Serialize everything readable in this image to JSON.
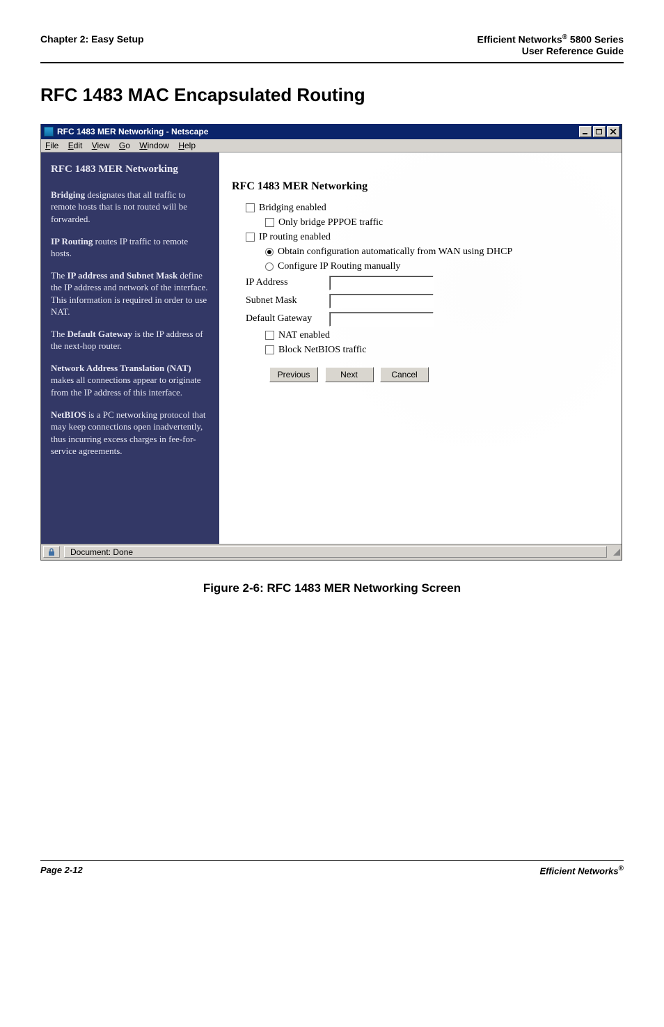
{
  "header": {
    "left": "Chapter 2: Easy Setup",
    "right_l1a": "Efficient Networks",
    "right_l1_sup": "®",
    "right_l1b": " 5800 Series",
    "right_l2": "User Reference Guide"
  },
  "heading_main": "RFC 1483 MAC Encapsulated Routing",
  "window": {
    "title": "RFC 1483 MER Networking - Netscape",
    "menus": {
      "file": "File",
      "edit": "Edit",
      "view": "View",
      "go": "Go",
      "window": "Window",
      "help": "Help"
    },
    "sidebar": {
      "title": "RFC 1483 MER Networking",
      "p1_a": "Bridging",
      "p1_b": " designates that all traffic to remote hosts that is not routed will be forwarded.",
      "p2_a": "IP Routing",
      "p2_b": " routes IP traffic to remote hosts.",
      "p3_a": "The ",
      "p3_b": "IP address and Subnet Mask",
      "p3_c": " define the IP address and network of the interface. This information is required in order to use NAT.",
      "p4_a": "The ",
      "p4_b": "Default Gateway",
      "p4_c": " is the IP address of the next-hop router.",
      "p5_a": "Network Address Translation (NAT)",
      "p5_b": " makes all connections appear to originate from the IP address of this interface.",
      "p6_a": "NetBIOS",
      "p6_b": " is a PC networking protocol that may keep connections open inadvertently, thus incurring excess charges in fee-for-service agreements."
    },
    "main": {
      "heading": "RFC 1483 MER Networking",
      "cb_bridging": "Bridging enabled",
      "cb_only_bridge": "Only bridge PPPOE traffic",
      "cb_iprouting": "IP routing enabled",
      "rb_obtain": "Obtain configuration automatically from WAN using DHCP",
      "rb_manual": "Configure IP Routing manually",
      "lbl_ip": "IP Address",
      "lbl_subnet": "Subnet Mask",
      "lbl_gateway": "Default Gateway",
      "cb_nat": "NAT enabled",
      "cb_netbios": "Block NetBIOS traffic",
      "btn_prev": "Previous",
      "btn_next": "Next",
      "btn_cancel": "Cancel"
    },
    "status": "Document: Done"
  },
  "caption": "Figure 2-6:  RFC 1483 MER Networking Screen",
  "footer": {
    "left": "Page 2-12",
    "right_a": "Efficient Networks",
    "right_sup": "®"
  }
}
